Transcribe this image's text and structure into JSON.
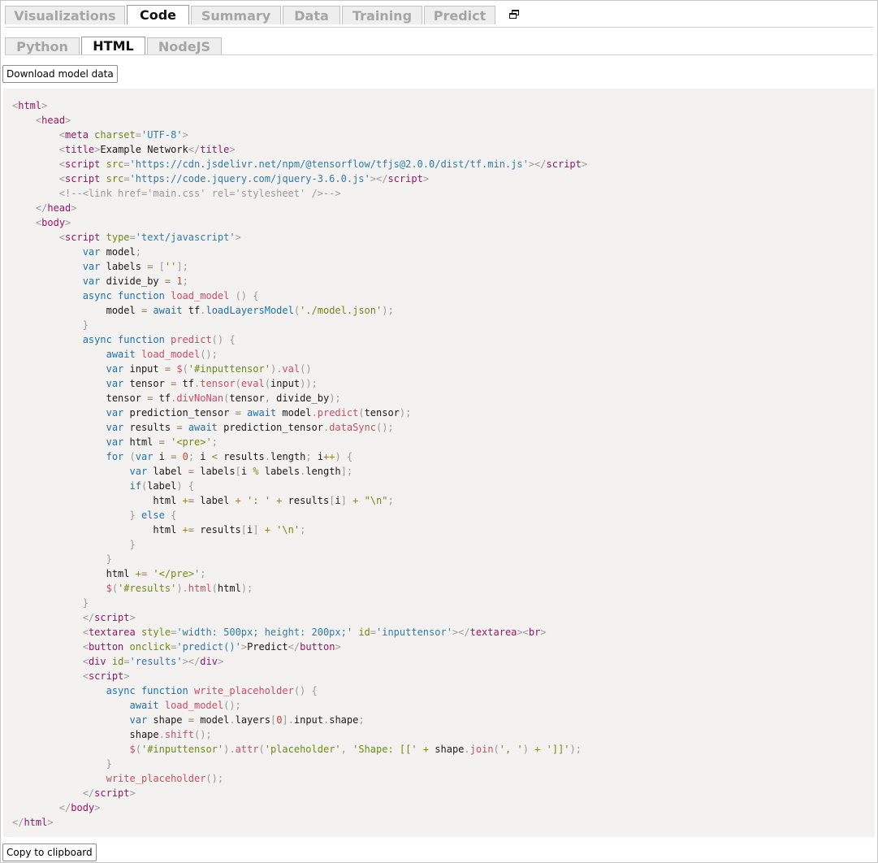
{
  "tabs": [
    "Visualizations",
    "Code",
    "Summary",
    "Data",
    "Training",
    "Predict"
  ],
  "sub_tabs": [
    "Python",
    "HTML",
    "NodeJS"
  ],
  "buttons": {
    "download": "Download model data",
    "copy": "Copy to clipboard"
  },
  "code": [
    [
      [
        "p",
        "<"
      ],
      [
        "t",
        "html"
      ],
      [
        "p",
        ">"
      ]
    ],
    [
      [
        "x",
        "    "
      ],
      [
        "p",
        "<"
      ],
      [
        "t",
        "head"
      ],
      [
        "p",
        ">"
      ]
    ],
    [
      [
        "x",
        "        "
      ],
      [
        "p",
        "<"
      ],
      [
        "t",
        "meta"
      ],
      [
        "x",
        " "
      ],
      [
        "a",
        "charset"
      ],
      [
        "p",
        "="
      ],
      [
        "s",
        "'UTF-8'"
      ],
      [
        "p",
        ">"
      ]
    ],
    [
      [
        "x",
        "        "
      ],
      [
        "p",
        "<"
      ],
      [
        "t",
        "title"
      ],
      [
        "p",
        ">"
      ],
      [
        "x",
        "Example Network"
      ],
      [
        "p",
        "</"
      ],
      [
        "t",
        "title"
      ],
      [
        "p",
        ">"
      ]
    ],
    [
      [
        "x",
        "        "
      ],
      [
        "p",
        "<"
      ],
      [
        "t",
        "script"
      ],
      [
        "x",
        " "
      ],
      [
        "a",
        "src"
      ],
      [
        "p",
        "="
      ],
      [
        "s",
        "'https://cdn.jsdelivr.net/npm/@tensorflow/tfjs@2.0.0/dist/tf.min.js'"
      ],
      [
        "p",
        "></"
      ],
      [
        "t",
        "script"
      ],
      [
        "p",
        ">"
      ]
    ],
    [
      [
        "x",
        "        "
      ],
      [
        "p",
        "<"
      ],
      [
        "t",
        "script"
      ],
      [
        "x",
        " "
      ],
      [
        "a",
        "src"
      ],
      [
        "p",
        "="
      ],
      [
        "s",
        "'https://code.jquery.com/jquery-3.6.0.js'"
      ],
      [
        "p",
        "></"
      ],
      [
        "t",
        "script"
      ],
      [
        "p",
        ">"
      ]
    ],
    [
      [
        "x",
        "        "
      ],
      [
        "c",
        "<!--<link href='main.css' rel='stylesheet' />-->"
      ]
    ],
    [
      [
        "x",
        "    "
      ],
      [
        "p",
        "</"
      ],
      [
        "t",
        "head"
      ],
      [
        "p",
        ">"
      ]
    ],
    [
      [
        "x",
        "    "
      ],
      [
        "p",
        "<"
      ],
      [
        "t",
        "body"
      ],
      [
        "p",
        ">"
      ]
    ],
    [
      [
        "x",
        "        "
      ],
      [
        "p",
        "<"
      ],
      [
        "t",
        "script"
      ],
      [
        "x",
        " "
      ],
      [
        "a",
        "type"
      ],
      [
        "p",
        "="
      ],
      [
        "s",
        "'text/javascript'"
      ],
      [
        "p",
        ">"
      ]
    ],
    [
      [
        "x",
        "            "
      ],
      [
        "k",
        "var"
      ],
      [
        "x",
        " model"
      ],
      [
        "p",
        ";"
      ]
    ],
    [
      [
        "x",
        "            "
      ],
      [
        "k",
        "var"
      ],
      [
        "x",
        " labels "
      ],
      [
        "o",
        "="
      ],
      [
        "x",
        " "
      ],
      [
        "p",
        "["
      ],
      [
        "g",
        "''"
      ],
      [
        "p",
        "];"
      ]
    ],
    [
      [
        "x",
        "            "
      ],
      [
        "k",
        "var"
      ],
      [
        "x",
        " divide_by "
      ],
      [
        "o",
        "="
      ],
      [
        "x",
        " "
      ],
      [
        "n",
        "1"
      ],
      [
        "p",
        ";"
      ]
    ],
    [
      [
        "x",
        "            "
      ],
      [
        "k",
        "async function"
      ],
      [
        "x",
        " "
      ],
      [
        "f",
        "load_model"
      ],
      [
        "x",
        " "
      ],
      [
        "p",
        "() {"
      ]
    ],
    [
      [
        "x",
        "                model "
      ],
      [
        "o",
        "="
      ],
      [
        "x",
        " "
      ],
      [
        "k",
        "await"
      ],
      [
        "x",
        " tf"
      ],
      [
        "p",
        "."
      ],
      [
        "k",
        "loadLayersModel"
      ],
      [
        "p",
        "("
      ],
      [
        "g",
        "'./model.json'"
      ],
      [
        "p",
        ");"
      ]
    ],
    [
      [
        "x",
        "            "
      ],
      [
        "p",
        "}"
      ]
    ],
    [
      [
        "x",
        "            "
      ],
      [
        "k",
        "async function"
      ],
      [
        "x",
        " "
      ],
      [
        "f",
        "predict"
      ],
      [
        "p",
        "() {"
      ]
    ],
    [
      [
        "x",
        "                "
      ],
      [
        "k",
        "await"
      ],
      [
        "x",
        " "
      ],
      [
        "f",
        "load_model"
      ],
      [
        "p",
        "();"
      ]
    ],
    [
      [
        "x",
        "                "
      ],
      [
        "k",
        "var"
      ],
      [
        "x",
        " input "
      ],
      [
        "o",
        "="
      ],
      [
        "x",
        " "
      ],
      [
        "f",
        "$"
      ],
      [
        "p",
        "("
      ],
      [
        "g",
        "'#inputtensor'"
      ],
      [
        "p",
        ")."
      ],
      [
        "f",
        "val"
      ],
      [
        "p",
        "()"
      ]
    ],
    [
      [
        "x",
        "                "
      ],
      [
        "k",
        "var"
      ],
      [
        "x",
        " tensor "
      ],
      [
        "o",
        "="
      ],
      [
        "x",
        " tf"
      ],
      [
        "p",
        "."
      ],
      [
        "f",
        "tensor"
      ],
      [
        "p",
        "("
      ],
      [
        "f",
        "eval"
      ],
      [
        "p",
        "("
      ],
      [
        "x",
        "input"
      ],
      [
        "p",
        "));"
      ]
    ],
    [
      [
        "x",
        "                tensor "
      ],
      [
        "o",
        "="
      ],
      [
        "x",
        " tf"
      ],
      [
        "p",
        "."
      ],
      [
        "f",
        "divNoNan"
      ],
      [
        "p",
        "("
      ],
      [
        "x",
        "tensor"
      ],
      [
        "p",
        ","
      ],
      [
        "x",
        " divide_by"
      ],
      [
        "p",
        ");"
      ]
    ],
    [
      [
        "x",
        "                "
      ],
      [
        "k",
        "var"
      ],
      [
        "x",
        " prediction_tensor "
      ],
      [
        "o",
        "="
      ],
      [
        "x",
        " "
      ],
      [
        "k",
        "await"
      ],
      [
        "x",
        " model"
      ],
      [
        "p",
        "."
      ],
      [
        "f",
        "predict"
      ],
      [
        "p",
        "("
      ],
      [
        "x",
        "tensor"
      ],
      [
        "p",
        ");"
      ]
    ],
    [
      [
        "x",
        "                "
      ],
      [
        "k",
        "var"
      ],
      [
        "x",
        " results "
      ],
      [
        "o",
        "="
      ],
      [
        "x",
        " "
      ],
      [
        "k",
        "await"
      ],
      [
        "x",
        " prediction_tensor"
      ],
      [
        "p",
        "."
      ],
      [
        "f",
        "dataSync"
      ],
      [
        "p",
        "();"
      ]
    ],
    [
      [
        "x",
        "                "
      ],
      [
        "k",
        "var"
      ],
      [
        "x",
        " html "
      ],
      [
        "o",
        "="
      ],
      [
        "x",
        " "
      ],
      [
        "g",
        "'<pre>'"
      ],
      [
        "p",
        ";"
      ]
    ],
    [
      [
        "x",
        "                "
      ],
      [
        "k",
        "for"
      ],
      [
        "x",
        " "
      ],
      [
        "p",
        "("
      ],
      [
        "k",
        "var"
      ],
      [
        "x",
        " i "
      ],
      [
        "o",
        "="
      ],
      [
        "x",
        " "
      ],
      [
        "n",
        "0"
      ],
      [
        "p",
        ";"
      ],
      [
        "x",
        " i "
      ],
      [
        "o",
        "<"
      ],
      [
        "x",
        " results"
      ],
      [
        "p",
        "."
      ],
      [
        "x",
        "length"
      ],
      [
        "p",
        ";"
      ],
      [
        "x",
        " i"
      ],
      [
        "o",
        "++"
      ],
      [
        "p",
        ") {"
      ]
    ],
    [
      [
        "x",
        "                    "
      ],
      [
        "k",
        "var"
      ],
      [
        "x",
        " label "
      ],
      [
        "o",
        "="
      ],
      [
        "x",
        " labels"
      ],
      [
        "p",
        "["
      ],
      [
        "x",
        "i "
      ],
      [
        "o",
        "%"
      ],
      [
        "x",
        " labels"
      ],
      [
        "p",
        "."
      ],
      [
        "x",
        "length"
      ],
      [
        "p",
        "];"
      ]
    ],
    [
      [
        "x",
        "                    "
      ],
      [
        "k",
        "if"
      ],
      [
        "p",
        "("
      ],
      [
        "x",
        "label"
      ],
      [
        "p",
        ") {"
      ]
    ],
    [
      [
        "x",
        "                        html "
      ],
      [
        "o",
        "+="
      ],
      [
        "x",
        " label "
      ],
      [
        "o",
        "+"
      ],
      [
        "x",
        " "
      ],
      [
        "g",
        "': '"
      ],
      [
        "x",
        " "
      ],
      [
        "o",
        "+"
      ],
      [
        "x",
        " results"
      ],
      [
        "p",
        "["
      ],
      [
        "x",
        "i"
      ],
      [
        "p",
        "]"
      ],
      [
        "x",
        " "
      ],
      [
        "o",
        "+"
      ],
      [
        "x",
        " "
      ],
      [
        "g",
        "\"\\n\""
      ],
      [
        "p",
        ";"
      ]
    ],
    [
      [
        "x",
        "                    "
      ],
      [
        "p",
        "} "
      ],
      [
        "k",
        "else"
      ],
      [
        "p",
        " {"
      ]
    ],
    [
      [
        "x",
        "                        html "
      ],
      [
        "o",
        "+="
      ],
      [
        "x",
        " results"
      ],
      [
        "p",
        "["
      ],
      [
        "x",
        "i"
      ],
      [
        "p",
        "]"
      ],
      [
        "x",
        " "
      ],
      [
        "o",
        "+"
      ],
      [
        "x",
        " "
      ],
      [
        "g",
        "'\\n'"
      ],
      [
        "p",
        ";"
      ]
    ],
    [
      [
        "x",
        "                    "
      ],
      [
        "p",
        "}"
      ]
    ],
    [
      [
        "x",
        "                "
      ],
      [
        "p",
        "}"
      ]
    ],
    [
      [
        "x",
        "                html "
      ],
      [
        "o",
        "+="
      ],
      [
        "x",
        " "
      ],
      [
        "g",
        "'</pre>'"
      ],
      [
        "p",
        ";"
      ]
    ],
    [
      [
        "x",
        "                "
      ],
      [
        "f",
        "$"
      ],
      [
        "p",
        "("
      ],
      [
        "g",
        "'#results'"
      ],
      [
        "p",
        ")."
      ],
      [
        "f",
        "html"
      ],
      [
        "p",
        "("
      ],
      [
        "x",
        "html"
      ],
      [
        "p",
        ");"
      ]
    ],
    [
      [
        "x",
        "            "
      ],
      [
        "p",
        "}"
      ]
    ],
    [
      [
        "x",
        "            "
      ],
      [
        "p",
        "</"
      ],
      [
        "t",
        "script"
      ],
      [
        "p",
        ">"
      ]
    ],
    [
      [
        "x",
        "            "
      ],
      [
        "p",
        "<"
      ],
      [
        "t",
        "textarea"
      ],
      [
        "x",
        " "
      ],
      [
        "a",
        "style"
      ],
      [
        "p",
        "="
      ],
      [
        "s",
        "'width: 500px; height: 200px;'"
      ],
      [
        "x",
        " "
      ],
      [
        "a",
        "id"
      ],
      [
        "p",
        "="
      ],
      [
        "s",
        "'inputtensor'"
      ],
      [
        "p",
        "></"
      ],
      [
        "t",
        "textarea"
      ],
      [
        "p",
        "><"
      ],
      [
        "t",
        "br"
      ],
      [
        "p",
        ">"
      ]
    ],
    [
      [
        "x",
        "            "
      ],
      [
        "p",
        "<"
      ],
      [
        "t",
        "button"
      ],
      [
        "x",
        " "
      ],
      [
        "a",
        "onclick"
      ],
      [
        "p",
        "="
      ],
      [
        "s",
        "'predict()'"
      ],
      [
        "p",
        ">"
      ],
      [
        "x",
        "Predict"
      ],
      [
        "p",
        "</"
      ],
      [
        "t",
        "button"
      ],
      [
        "p",
        ">"
      ]
    ],
    [
      [
        "x",
        "            "
      ],
      [
        "p",
        "<"
      ],
      [
        "t",
        "div"
      ],
      [
        "x",
        " "
      ],
      [
        "a",
        "id"
      ],
      [
        "p",
        "="
      ],
      [
        "s",
        "'results'"
      ],
      [
        "p",
        "></"
      ],
      [
        "t",
        "div"
      ],
      [
        "p",
        ">"
      ]
    ],
    [
      [
        "x",
        "            "
      ],
      [
        "p",
        "<"
      ],
      [
        "t",
        "script"
      ],
      [
        "p",
        ">"
      ]
    ],
    [
      [
        "x",
        "                "
      ],
      [
        "k",
        "async function"
      ],
      [
        "x",
        " "
      ],
      [
        "f",
        "write_placeholder"
      ],
      [
        "p",
        "() {"
      ]
    ],
    [
      [
        "x",
        "                    "
      ],
      [
        "k",
        "await"
      ],
      [
        "x",
        " "
      ],
      [
        "f",
        "load_model"
      ],
      [
        "p",
        "();"
      ]
    ],
    [
      [
        "x",
        "                    "
      ],
      [
        "k",
        "var"
      ],
      [
        "x",
        " shape "
      ],
      [
        "o",
        "="
      ],
      [
        "x",
        " model"
      ],
      [
        "p",
        "."
      ],
      [
        "x",
        "layers"
      ],
      [
        "p",
        "["
      ],
      [
        "n",
        "0"
      ],
      [
        "p",
        "]."
      ],
      [
        "x",
        "input"
      ],
      [
        "p",
        "."
      ],
      [
        "x",
        "shape"
      ],
      [
        "p",
        ";"
      ]
    ],
    [
      [
        "x",
        "                    shape"
      ],
      [
        "p",
        "."
      ],
      [
        "f",
        "shift"
      ],
      [
        "p",
        "();"
      ]
    ],
    [
      [
        "x",
        "                    "
      ],
      [
        "f",
        "$"
      ],
      [
        "p",
        "("
      ],
      [
        "g",
        "'#inputtensor'"
      ],
      [
        "p",
        ")."
      ],
      [
        "f",
        "attr"
      ],
      [
        "p",
        "("
      ],
      [
        "g",
        "'placeholder'"
      ],
      [
        "p",
        ", "
      ],
      [
        "g",
        "'Shape: [['"
      ],
      [
        "x",
        " "
      ],
      [
        "o",
        "+"
      ],
      [
        "x",
        " shape"
      ],
      [
        "p",
        "."
      ],
      [
        "f",
        "join"
      ],
      [
        "p",
        "("
      ],
      [
        "g",
        "', '"
      ],
      [
        "p",
        ")"
      ],
      [
        "x",
        " "
      ],
      [
        "o",
        "+"
      ],
      [
        "x",
        " "
      ],
      [
        "g",
        "']]'"
      ],
      [
        "p",
        ");"
      ]
    ],
    [
      [
        "x",
        "                "
      ],
      [
        "p",
        "}"
      ]
    ],
    [
      [
        "x",
        "                "
      ],
      [
        "f",
        "write_placeholder"
      ],
      [
        "p",
        "();"
      ]
    ],
    [
      [
        "x",
        "            "
      ],
      [
        "p",
        "</"
      ],
      [
        "t",
        "script"
      ],
      [
        "p",
        ">"
      ]
    ],
    [
      [
        "x",
        "        "
      ],
      [
        "p",
        "</"
      ],
      [
        "t",
        "body"
      ],
      [
        "p",
        ">"
      ]
    ],
    [
      [
        "p",
        "</"
      ],
      [
        "t",
        "html"
      ],
      [
        "p",
        ">"
      ]
    ]
  ]
}
